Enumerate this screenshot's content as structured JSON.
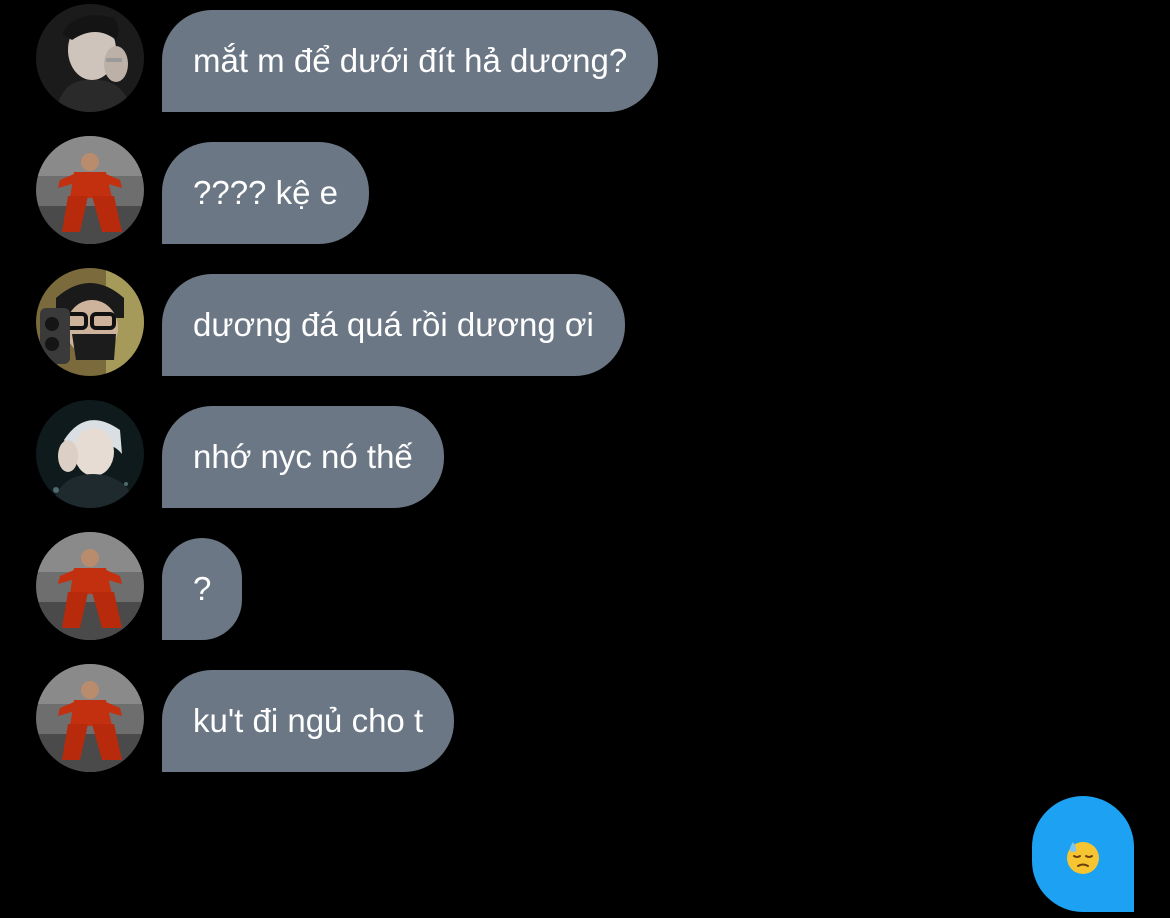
{
  "messages": [
    {
      "text": "mắt m để dưới đít hả dương?",
      "avatar": "avatar-hand-face"
    },
    {
      "text": "???? kệ e",
      "avatar": "avatar-red-outfit"
    },
    {
      "text": "dương đá quá rồi dương ơi",
      "avatar": "avatar-glasses-phone"
    },
    {
      "text": "nhớ nyc nó thế",
      "avatar": "avatar-silver-hair"
    },
    {
      "text": "?",
      "avatar": "avatar-red-outfit"
    },
    {
      "text": "ku't đi ngủ cho t",
      "avatar": "avatar-red-outfit"
    }
  ],
  "sent_message": {
    "emoji": "downcast-face-with-sweat-icon"
  },
  "colors": {
    "background": "#000000",
    "received_bubble": "#6b7785",
    "sent_bubble": "#1da1f2",
    "text": "#ffffff"
  }
}
